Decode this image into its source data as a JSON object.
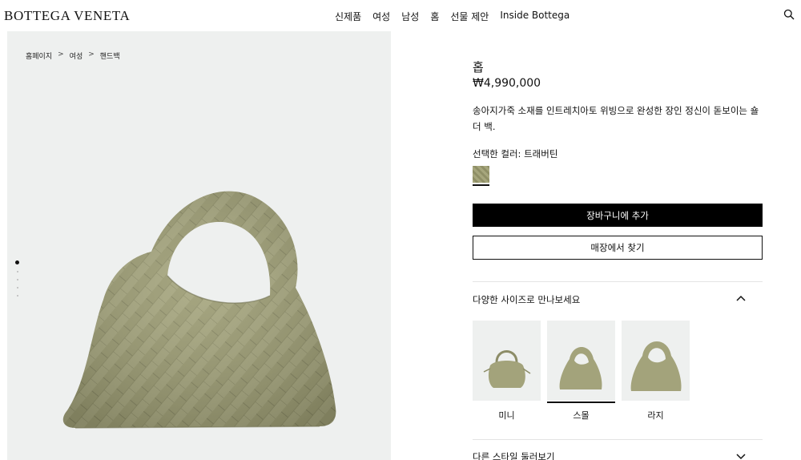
{
  "header": {
    "logo": "BOTTEGA VENETA",
    "nav": [
      "신제품",
      "여성",
      "남성",
      "홈",
      "선물 제안",
      "Inside Bottega"
    ]
  },
  "breadcrumb": [
    "홈페이지",
    "여성",
    "핸드백"
  ],
  "breadcrumb_separator": ">",
  "gallery": {
    "total_images": 5,
    "active_index": 0
  },
  "product": {
    "name": "홉",
    "price": "₩4,990,000",
    "description": "송아지가죽 소재를 인트레치아토 위빙으로 완성한 장인 정신이 돋보이는 숄더 백.",
    "color_label": "선택한 컬러: 트래버틴",
    "add_to_cart": "장바구니에 추가",
    "find_in_store": "매장에서 찾기"
  },
  "sizes_section": {
    "title": "다양한 사이즈로 만나보세요",
    "expanded": true,
    "items": [
      {
        "label": "미니",
        "selected": false
      },
      {
        "label": "스몰",
        "selected": true
      },
      {
        "label": "라지",
        "selected": false
      }
    ]
  },
  "styles_section": {
    "title": "다른 스타일 둘러보기",
    "expanded": false
  },
  "colors": {
    "bag": "#a3a37b",
    "bag_dark": "#7f7f5c",
    "gallery_bg": "#eef0ef"
  }
}
